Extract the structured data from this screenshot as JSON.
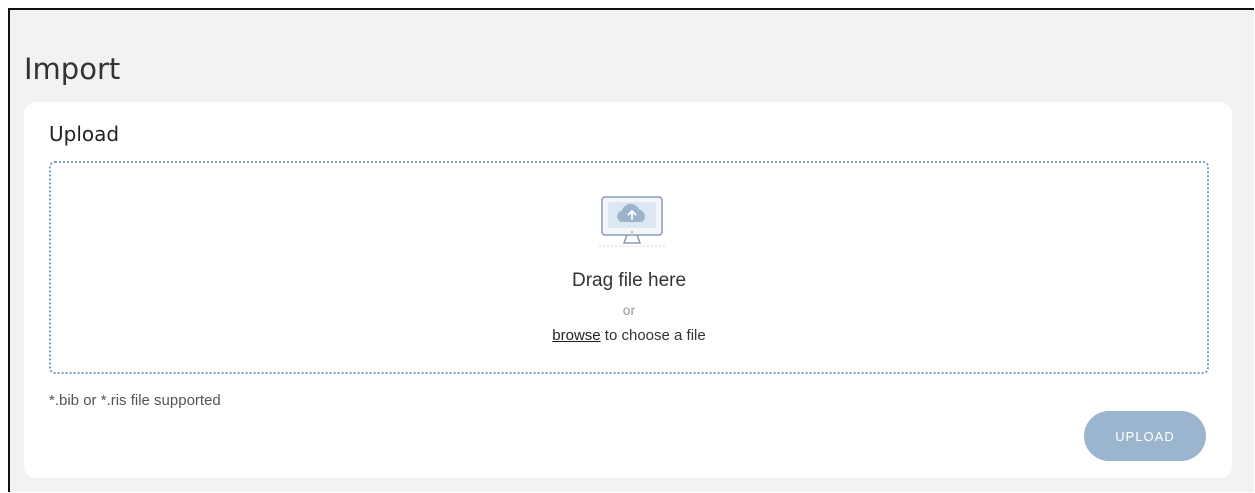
{
  "page": {
    "title": "Import"
  },
  "upload": {
    "title": "Upload",
    "dropzone": {
      "icon": "cloud-upload-monitor-icon",
      "title": "Drag file here",
      "or": "or",
      "browse_link": "browse",
      "browse_suffix": " to choose a file"
    },
    "hint": "*.bib or *.ris file supported",
    "button_label": "UPLOAD"
  },
  "colors": {
    "page_bg": "#f2f2f2",
    "card_bg": "#ffffff",
    "dropzone_border": "#7da0c4",
    "button_bg": "#9cb5ce",
    "button_text": "#ffffff"
  }
}
